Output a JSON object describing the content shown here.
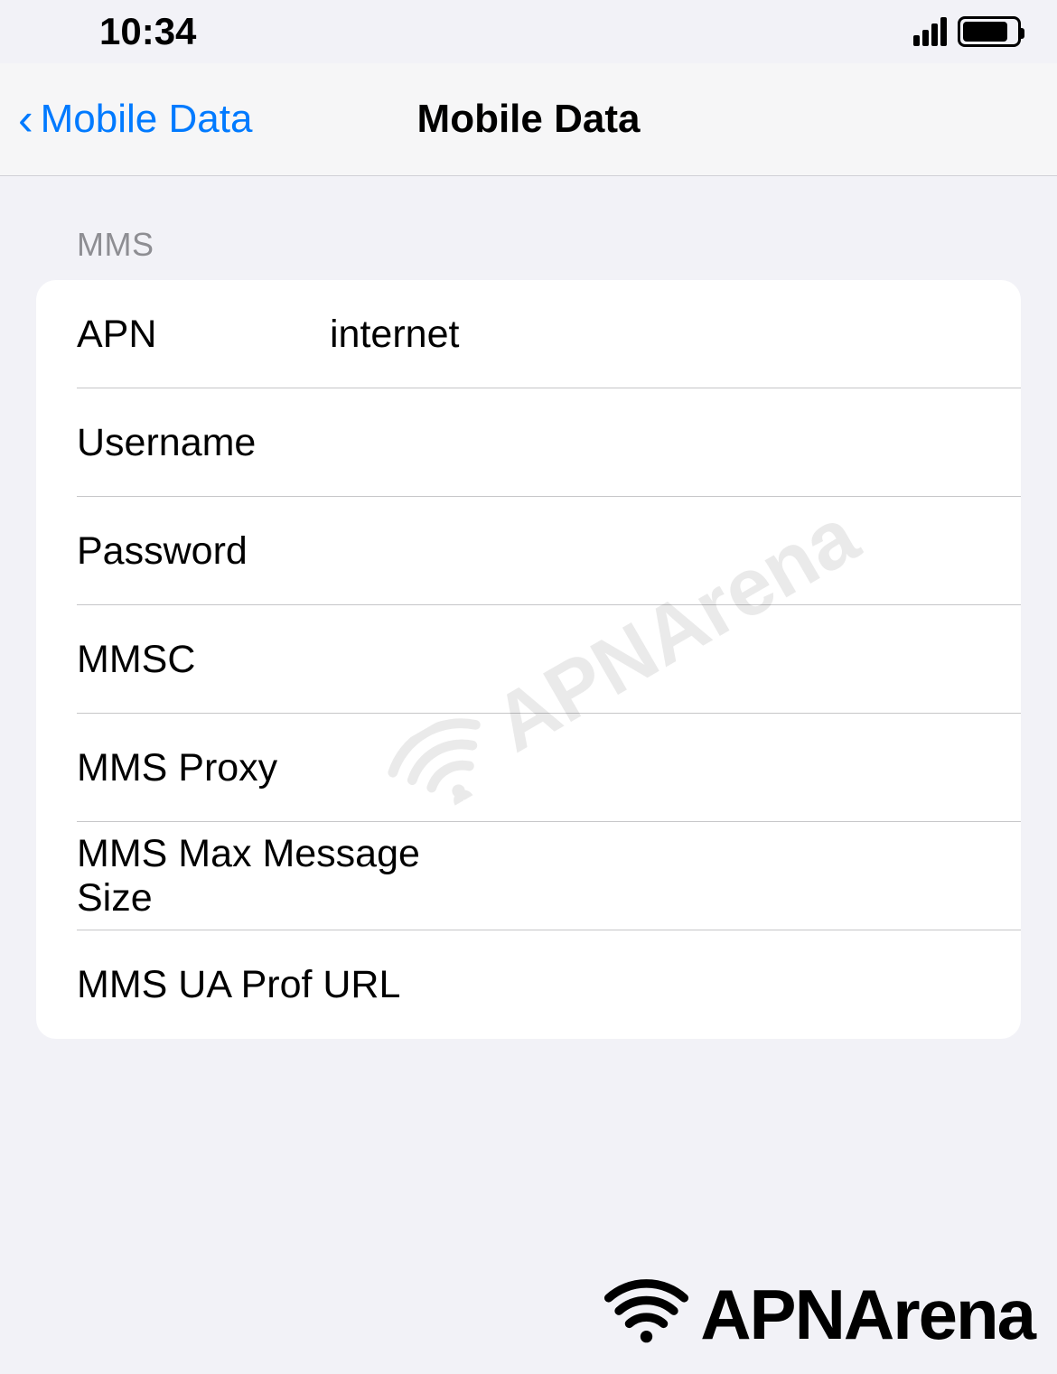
{
  "status_bar": {
    "time": "10:34"
  },
  "nav": {
    "back_label": "Mobile Data",
    "title": "Mobile Data"
  },
  "section": {
    "header": "MMS",
    "rows": [
      {
        "label": "APN",
        "value": "internet"
      },
      {
        "label": "Username",
        "value": ""
      },
      {
        "label": "Password",
        "value": ""
      },
      {
        "label": "MMSC",
        "value": ""
      },
      {
        "label": "MMS Proxy",
        "value": ""
      },
      {
        "label": "MMS Max Message Size",
        "value": ""
      },
      {
        "label": "MMS UA Prof URL",
        "value": ""
      }
    ]
  },
  "branding": {
    "text": "APNArena"
  }
}
